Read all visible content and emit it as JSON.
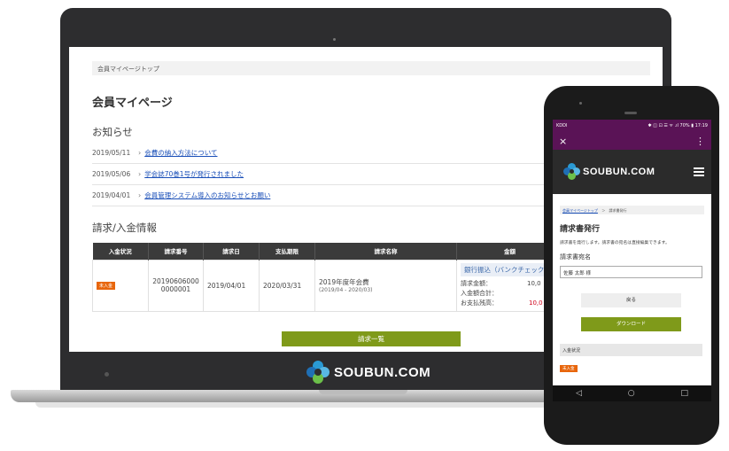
{
  "laptop": {
    "breadcrumb": "会員マイページトップ",
    "page_title": "会員マイページ",
    "news_heading": "お知らせ",
    "news": [
      {
        "date": "2019/05/11",
        "title": "会費の納入方法について"
      },
      {
        "date": "2019/05/06",
        "title": "学会誌70巻1号が発行されました"
      },
      {
        "date": "2019/04/01",
        "title": "会員管理システム導入のお知らせとお願い"
      }
    ],
    "billing_heading": "請求/入金情報",
    "table": {
      "headers": [
        "入金状況",
        "請求番号",
        "請求日",
        "支払期限",
        "請求名称",
        "金額"
      ],
      "row": {
        "status": "未入金",
        "number_line1": "20190606000",
        "number_line2": "0000001",
        "date": "2019/04/01",
        "due": "2020/03/31",
        "name": "2019年度年会費",
        "period": "(2019/04 - 2020/03)",
        "pay_method": "銀行振込（バンクチェック",
        "billed_label": "請求金額：",
        "billed_value": "10,0",
        "paid_label": "入金額合計：",
        "balance_label": "お支払残高：",
        "balance_value": "10,0"
      }
    },
    "list_button": "請求一覧",
    "brand": "SOUBUN.COM"
  },
  "phone": {
    "carrier": "KDDI",
    "status_right": "✱ ◫ ⊡ ☰ ᯤ .ıl 70% ▮ 17:19",
    "close": "×",
    "menu": "⋮",
    "brand": "SOUBUN.COM",
    "breadcrumb_link": "会員マイページトップ",
    "breadcrumb_sep": "＞",
    "breadcrumb_current": "請求書発行",
    "title": "請求書発行",
    "description": "請求書を発行します。請求書の宛名は直接編集できます。",
    "addressee_label": "請求書宛名",
    "addressee_value": "佐藤 太郎 様",
    "back_button": "戻る",
    "download_button": "ダウンロード",
    "section_label": "入金状況",
    "status_badge": "未入金",
    "nav": {
      "back": "◁",
      "home": "○",
      "recent": "□"
    }
  },
  "colors": {
    "accent_green": "#7f9a1a",
    "unpaid_orange": "#e8660c",
    "phone_appbar": "#5a1356",
    "link_blue": "#1a4fb8",
    "device_frame": "#2d2d2f"
  }
}
